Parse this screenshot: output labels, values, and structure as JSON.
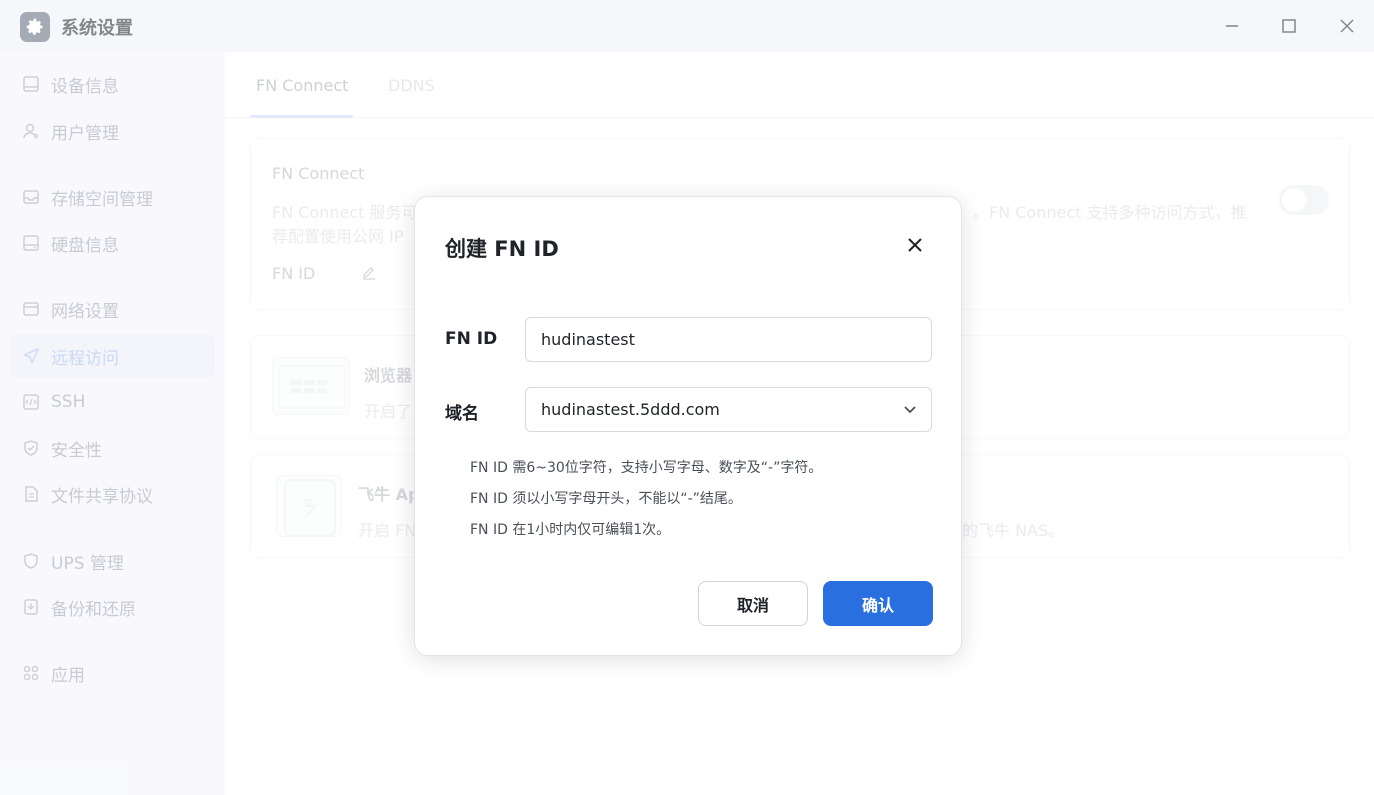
{
  "window": {
    "title": "系统设置",
    "icon": "gear-icon"
  },
  "sidebar": {
    "items": [
      {
        "label": "设备信息",
        "icon": "monitor-icon"
      },
      {
        "label": "用户管理",
        "icon": "user-icon"
      },
      {
        "label": "存储空间管理",
        "icon": "storage-icon"
      },
      {
        "label": "硬盘信息",
        "icon": "disk-icon"
      },
      {
        "label": "网络设置",
        "icon": "network-icon"
      },
      {
        "label": "远程访问",
        "icon": "send-icon",
        "active": true
      },
      {
        "label": "SSH",
        "icon": "code-icon"
      },
      {
        "label": "安全性",
        "icon": "shield-check-icon"
      },
      {
        "label": "文件共享协议",
        "icon": "file-icon"
      },
      {
        "label": "UPS 管理",
        "icon": "shield-icon"
      },
      {
        "label": "备份和还原",
        "icon": "backup-icon"
      },
      {
        "label": "应用",
        "icon": "apps-icon"
      }
    ]
  },
  "tabs": [
    {
      "label": "FN Connect",
      "active": true
    },
    {
      "label": "DDNS",
      "active": false
    }
  ],
  "background_cards": {
    "connect": {
      "title": "FN Connect",
      "desc_left": "FN Connect 服务可",
      "desc_right": "。FN Connect 支持多种访问方式，推",
      "desc_line2": "荐配置使用公网 IP",
      "fn_id_label": "FN ID"
    },
    "browser": {
      "title": "浏览器",
      "desc": "开启了"
    },
    "app": {
      "title": "飞牛 Ap",
      "desc_left": "开启 FN",
      "desc_right": "的飞牛 NAS。"
    }
  },
  "dialog": {
    "title": "创建 FN ID",
    "fn_id_label": "FN ID",
    "fn_id_value": "hudinastest",
    "domain_label": "域名",
    "domain_value": "hudinastest.5ddd.com",
    "hints": [
      "FN ID 需6~30位字符，支持小写字母、数字及“-”字符。",
      "FN ID 须以小写字母开头，不能以“-”结尾。",
      "FN ID 在1小时内仅可编辑1次。"
    ],
    "cancel_label": "取消",
    "confirm_label": "确认"
  },
  "colors": {
    "accent": "#2a6fe0",
    "sidebar_bg": "#f4f5fb",
    "titlebar_bg": "#eef0f6"
  }
}
